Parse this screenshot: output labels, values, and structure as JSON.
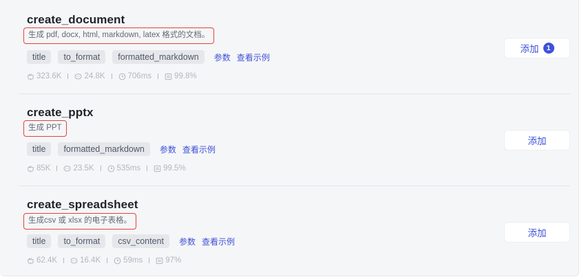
{
  "tools": [
    {
      "name": "create_document",
      "description": "生成 pdf, docx, html, markdown, latex 格式的文档。",
      "params": [
        "title",
        "to_format",
        "formatted_markdown"
      ],
      "params_link": "参数",
      "example_link": "查看示例",
      "stats": {
        "uses": "323.6K",
        "calls": "24.8K",
        "latency": "706ms",
        "success": "99.8%"
      },
      "add_label": "添加",
      "badge": "1"
    },
    {
      "name": "create_pptx",
      "description": "生成 PPT",
      "params": [
        "title",
        "formatted_markdown"
      ],
      "params_link": "参数",
      "example_link": "查看示例",
      "stats": {
        "uses": "85K",
        "calls": "23.5K",
        "latency": "535ms",
        "success": "99.5%"
      },
      "add_label": "添加"
    },
    {
      "name": "create_spreadsheet",
      "description": "生成csv 或 xlsx 的电子表格。",
      "params": [
        "title",
        "to_format",
        "csv_content"
      ],
      "params_link": "参数",
      "example_link": "查看示例",
      "stats": {
        "uses": "62.4K",
        "calls": "16.4K",
        "latency": "59ms",
        "success": "97%"
      },
      "add_label": "添加"
    }
  ],
  "icons": {
    "uses": "plugin-icon",
    "calls": "chat-bubble-icon",
    "latency": "clock-icon",
    "success": "message-square-icon"
  },
  "colors": {
    "accent": "#3f51d8",
    "highlight_border": "#e5413d",
    "panel_bg": "#f5f6f8",
    "tag_bg": "#e6e7ea"
  }
}
